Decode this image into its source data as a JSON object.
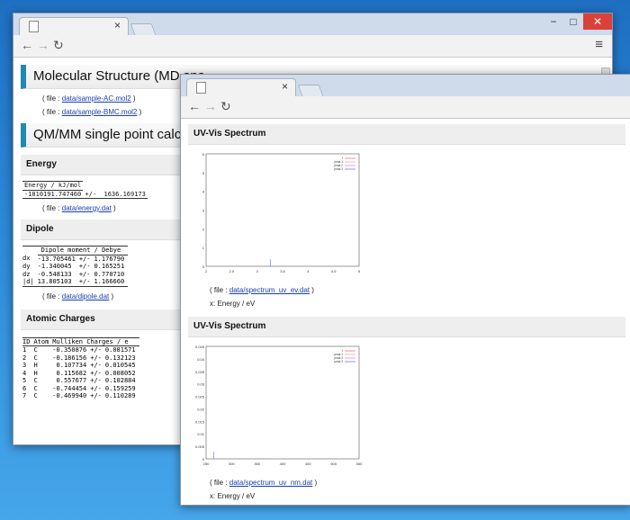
{
  "win1": {
    "window_controls": {
      "minimize": "−",
      "maximize": "□",
      "close": "✕"
    },
    "tab_close": "×",
    "nav": {
      "back": "←",
      "forward": "→",
      "reload": "↻"
    },
    "menu": "≡",
    "sections": {
      "mol_title": "Molecular Structure (MD sna",
      "mol_files": [
        "data/sample-AC.mol2",
        "data/sample-BMC.mol2"
      ],
      "qmmm_title": "QM/MM single point calculati",
      "energy_title": "Energy",
      "energy_header": "Energy / kJ/mol",
      "energy_row": "-1810191.747460 +/-  1636.169173",
      "energy_file": "data/energy.dat",
      "dipole_title": "Dipole",
      "dipole_header": "Dipole moment / Debye",
      "dipole_rows": [
        [
          "dx",
          "-13.705461",
          "+/-",
          "1.176790"
        ],
        [
          "dy",
          "-1.340045",
          "+/-",
          "0.165251"
        ],
        [
          "dz",
          "-0.548133",
          "+/-",
          "0.770710"
        ],
        [
          "|d|",
          "13.805103",
          "+/-",
          "1.166660"
        ]
      ],
      "dipole_file": "data/dipole.dat",
      "charges_title": "Atomic Charges",
      "charges_headers": [
        "ID",
        "Atom",
        "Mulliken Charges / e"
      ],
      "charges_rows": [
        [
          "1",
          "C",
          "-0.350876",
          "+/-",
          "0.081571"
        ],
        [
          "2",
          "C",
          "-0.186156",
          "+/-",
          "0.132123"
        ],
        [
          "3",
          "H",
          "0.107734",
          "+/-",
          "0.010545"
        ],
        [
          "4",
          "H",
          "0.115682",
          "+/-",
          "0.008052"
        ],
        [
          "5",
          "C",
          "0.557677",
          "+/-",
          "0.102884"
        ],
        [
          "6",
          "C",
          "-0.744454",
          "+/-",
          "0.159259"
        ],
        [
          "7",
          "C",
          "-0.469940",
          "+/-",
          "0.110289"
        ]
      ]
    },
    "file_prefix": "( file : ",
    "file_suffix": " )"
  },
  "win2": {
    "tab_close": "×",
    "nav": {
      "back": "←",
      "forward": "→",
      "reload": "↻"
    },
    "spectrum1_title": "UV-Vis Spectrum",
    "spectrum1_file": "data/spectrum_uv_ev.dat",
    "spectrum1_xlabel": "x: Energy / eV",
    "spectrum2_title": "UV-Vis Spectrum",
    "spectrum2_file": "data/spectrum_uv_nm.dat",
    "spectrum2_xlabel": "x: Energy / eV",
    "file_prefix": "( file : ",
    "file_suffix": " )",
    "plot1_yticks": [
      "6",
      "5",
      "4",
      "3",
      "2",
      "1",
      "0"
    ],
    "plot1_xticks": [
      "2",
      "2.5",
      "3",
      "3.5",
      "4",
      "4.5",
      "5"
    ],
    "plot1_legend": [
      "f",
      "peak 1",
      "peak 2",
      "peak 3"
    ],
    "plot2_yticks": [
      "0.045",
      "0.04",
      "0.035",
      "0.03",
      "0.025",
      "0.02",
      "0.015",
      "0.01",
      "0.005",
      "0"
    ],
    "plot2_xticks": [
      "250",
      "300",
      "350",
      "400",
      "450",
      "500",
      "550"
    ],
    "plot2_legend": [
      "f",
      "peak 1",
      "peak 2",
      "peak 3"
    ]
  },
  "colors": {
    "accent": "#1e8ab4",
    "link": "#1a3fb0",
    "spectrum_red": "#d9454f",
    "spectrum_blue": "#3a4fc9",
    "close_red": "#d9413a"
  }
}
